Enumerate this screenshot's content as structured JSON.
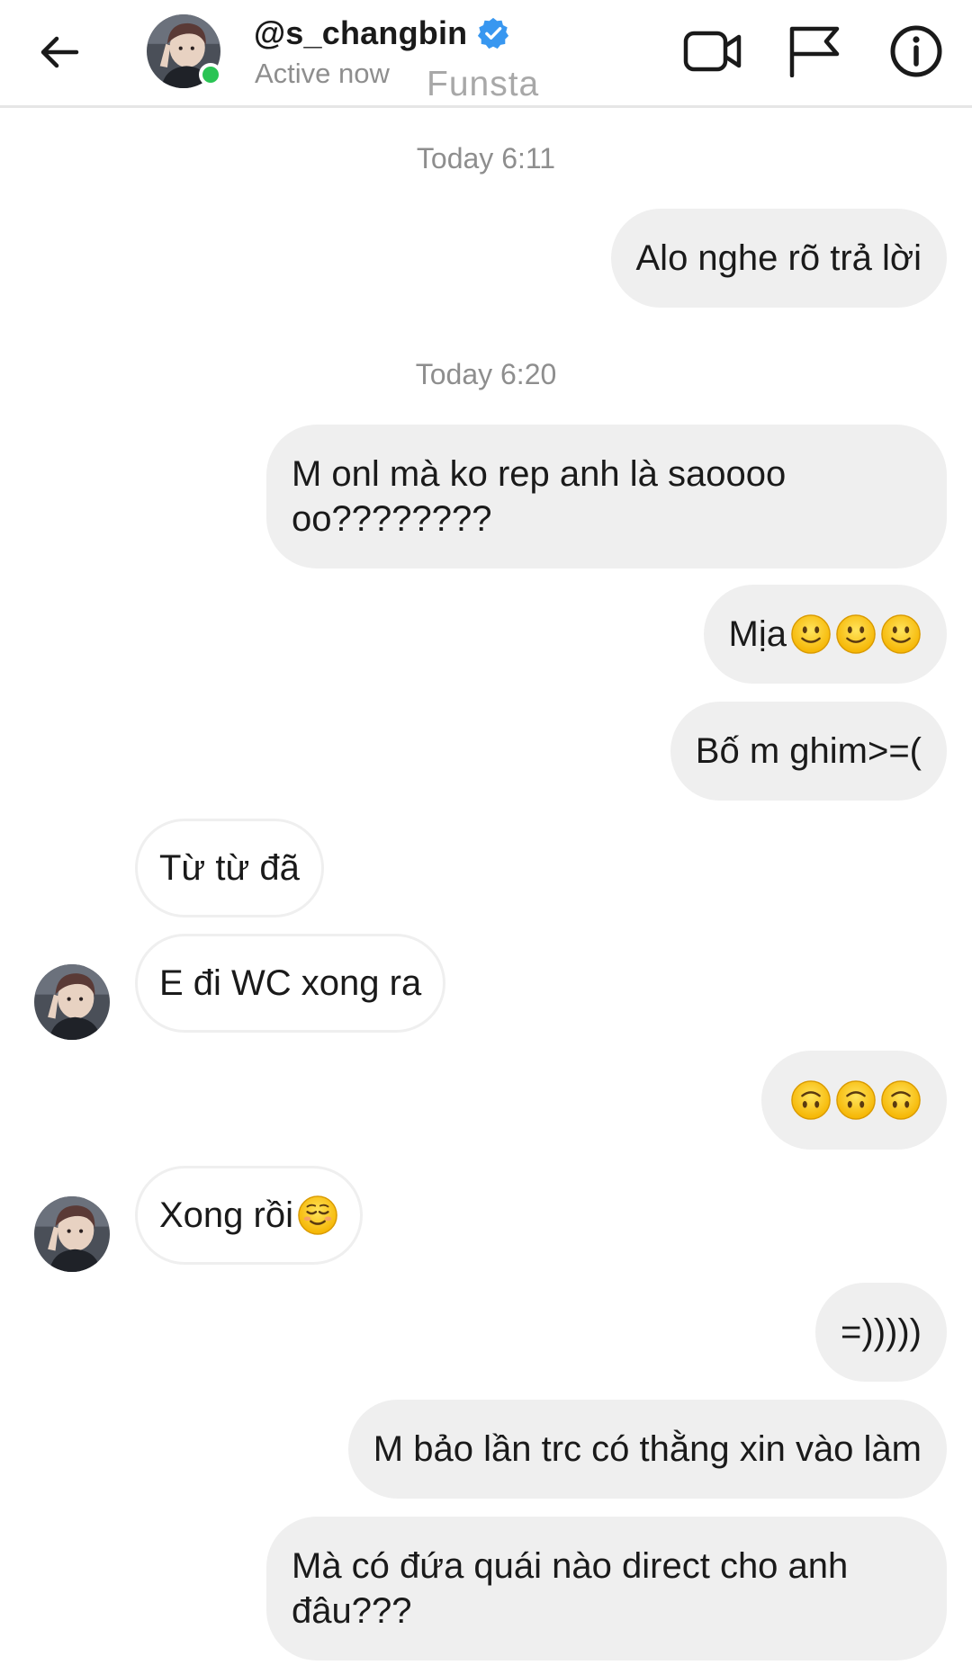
{
  "header": {
    "username": "@s_changbin",
    "status": "Active now",
    "watermark": "Funsta",
    "icons": {
      "back": "arrow-left-icon",
      "avatar": "profile-photo",
      "verified": "verified-badge-icon",
      "video": "video-camera-icon",
      "flag": "flag-icon",
      "info": "info-icon"
    },
    "colors": {
      "online": "#2ac454",
      "verified": "#3897f0"
    }
  },
  "chat": {
    "timestamps": [
      "Today 6:11",
      "Today 6:20"
    ],
    "messages": [
      {
        "side": "out",
        "text": "Alo nghe rõ trả lời"
      },
      {
        "side": "out",
        "text": "M onl mà ko rep anh là saoooooo????????"
      },
      {
        "side": "out",
        "text": "Mịa",
        "emoji": [
          "slightly-smiling-face",
          "slightly-smiling-face",
          "slightly-smiling-face"
        ]
      },
      {
        "side": "out",
        "text": "Bố m ghim>=("
      },
      {
        "side": "in",
        "text": "Từ từ đã"
      },
      {
        "side": "in",
        "text": "E đi WC xong ra"
      },
      {
        "side": "out",
        "text": "",
        "emoji": [
          "upside-down-face",
          "upside-down-face",
          "upside-down-face"
        ]
      },
      {
        "side": "in",
        "text": "Xong rồi",
        "emoji": [
          "relieved-face"
        ]
      },
      {
        "side": "out",
        "text": "=)))))"
      },
      {
        "side": "out",
        "text": "M bảo lần trc có thằng xin vào làm"
      },
      {
        "side": "out",
        "text": "Mà có đứa quái nào direct cho anh đâu???"
      }
    ],
    "colors": {
      "outgoing_bubble": "#efefef",
      "incoming_border": "#efefef",
      "timestamp": "#8e8e8e"
    }
  }
}
